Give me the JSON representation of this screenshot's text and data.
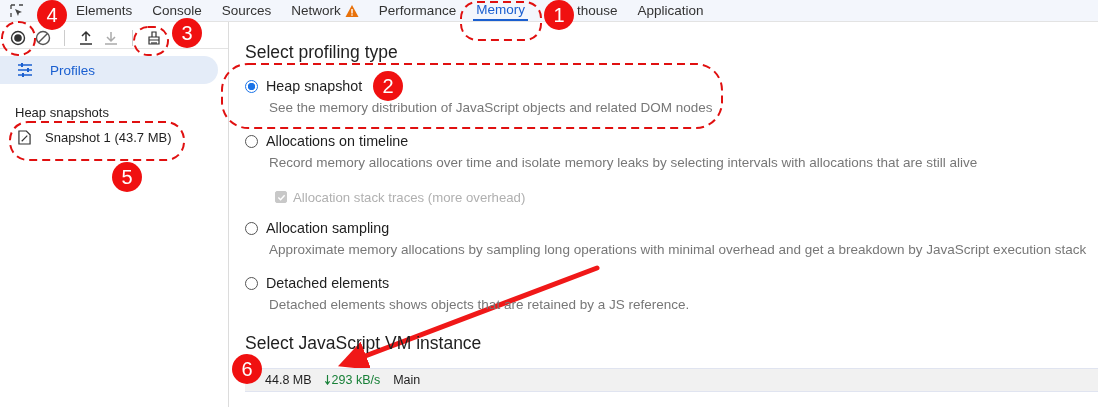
{
  "tabs": [
    {
      "label": "Elements",
      "selected": false,
      "warning": false
    },
    {
      "label": "Console",
      "selected": false,
      "warning": false
    },
    {
      "label": "Sources",
      "selected": false,
      "warning": false
    },
    {
      "label": "Network",
      "selected": false,
      "warning": true
    },
    {
      "label": "Performance",
      "selected": false,
      "warning": false
    },
    {
      "label": "Memory",
      "selected": true,
      "warning": false
    },
    {
      "label": "thouse",
      "selected": false,
      "warning": false
    },
    {
      "label": "Application",
      "selected": false,
      "warning": false
    }
  ],
  "sidebar": {
    "header": "Profiles",
    "section": "Heap snapshots",
    "items": [
      {
        "label": "Snapshot 1 (43.7 MB)"
      }
    ]
  },
  "profiling": {
    "title": "Select profiling type",
    "types": [
      {
        "label": "Heap snapshot",
        "description": "See the memory distribution of JavaScript objects and related DOM nodes",
        "selected": true
      },
      {
        "label": "Allocations on timeline",
        "description": "Record memory allocations over time and isolate memory leaks by selecting intervals with allocations that are still alive",
        "selected": false,
        "option": {
          "label": "Allocation stack traces (more overhead)",
          "checked": true,
          "disabled": true
        }
      },
      {
        "label": "Allocation sampling",
        "description": "Approximate memory allocations by sampling long operations with minimal overhead and get a breakdown by JavaScript execution stack",
        "selected": false
      },
      {
        "label": "Detached elements",
        "description": "Detached elements shows objects that are retained by a JS reference.",
        "selected": false
      }
    ]
  },
  "vm": {
    "title": "Select JavaScript VM instance",
    "instances": [
      {
        "size": "44.8 MB",
        "rate": "293 kB/s",
        "name": "Main"
      }
    ]
  },
  "annotations": [
    {
      "label": "4"
    },
    {
      "label": "3"
    },
    {
      "label": "1"
    },
    {
      "label": "2"
    },
    {
      "label": "5"
    },
    {
      "label": "6"
    }
  ]
}
